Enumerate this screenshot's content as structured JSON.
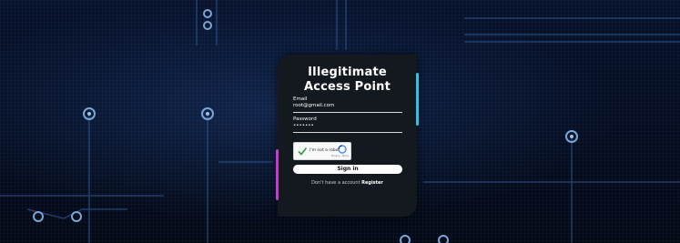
{
  "login": {
    "title_line1": "Illegitimate",
    "title_line2": "Access Point",
    "email_label": "Email",
    "email_value": "root@gmail.com",
    "password_label": "Password",
    "password_value": "•••••••",
    "captcha_label": "I'm not a robot",
    "captcha_legal": "Privacy - Terms",
    "captcha_checked": true,
    "signin_label": "Sign in",
    "no_account_text": "Don't have a account",
    "register_label": "Register"
  },
  "colors": {
    "background": "#050b1a",
    "card": "#14181f",
    "accent_cyan": "#2ec4e6",
    "accent_magenta": "#c83ad6",
    "check_green": "#2e9e3b"
  },
  "icons": {
    "captcha_check": "check-icon",
    "captcha_logo": "recaptcha-icon"
  }
}
